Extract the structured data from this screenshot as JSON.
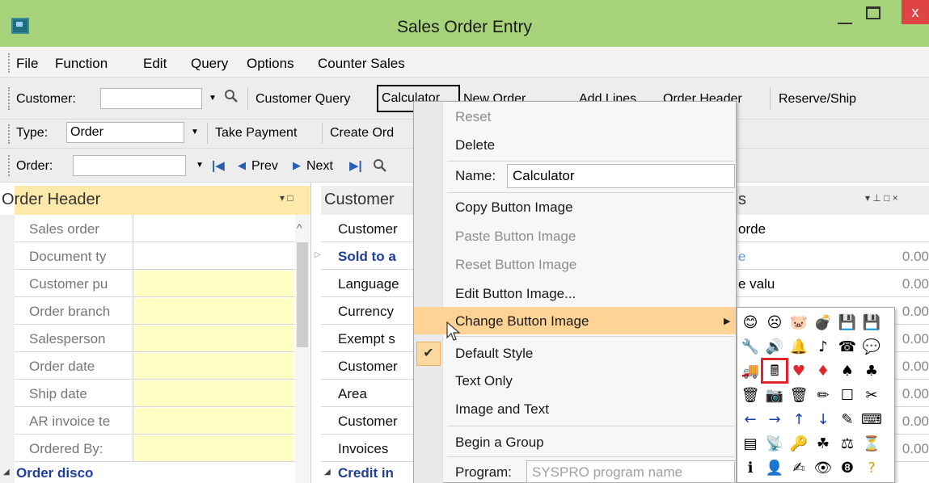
{
  "window": {
    "title": "Sales Order Entry",
    "close_glyph": "x"
  },
  "menubar": {
    "items": [
      "File",
      "Function",
      "Edit",
      "Query",
      "Options",
      "Counter Sales"
    ]
  },
  "toolbar1": {
    "customer_label": "Customer:",
    "customer_value": "",
    "customer_query": "Customer Query",
    "calculator": "Calculator",
    "new_order": "New Order",
    "add_lines": "Add Lines",
    "order_header": "Order Header",
    "reserve_ship": "Reserve/Ship"
  },
  "toolbar2": {
    "type_label": "Type:",
    "type_value": "Order",
    "take_payment": "Take Payment",
    "create_order": "Create Ord"
  },
  "toolbar3": {
    "order_label": "Order:",
    "order_value": "",
    "prev": "Prev",
    "next": "Next"
  },
  "left_pane": {
    "title": "Order Header",
    "rows": [
      "Sales order",
      "Document ty",
      "Customer pu",
      "Order branch",
      "Salesperson",
      "Order date",
      "Ship date",
      "AR invoice te",
      "Ordered By:"
    ],
    "section": "Order disco"
  },
  "right_pane": {
    "title": "Customer",
    "title_right": "s",
    "rows": [
      {
        "label": "Customer",
        "right": "orde",
        "value": ""
      },
      {
        "label": "Sold to a",
        "right": "e",
        "value": "0.00"
      },
      {
        "label": "Language",
        "right": "e valu",
        "value": "0.00"
      },
      {
        "label": "Currency",
        "right": "",
        "value": "0.00"
      },
      {
        "label": "Exempt s",
        "right": "",
        "value": "0.00"
      },
      {
        "label": "Customer",
        "right": "",
        "value": "0.00"
      },
      {
        "label": "Area",
        "right": "",
        "value": "0.00"
      },
      {
        "label": "Customer",
        "right": "",
        "value": "0.00"
      },
      {
        "label": "Invoices",
        "right": "",
        "value": "0.00"
      }
    ],
    "section": "Credit in"
  },
  "context_menu": {
    "reset": "Reset",
    "delete": "Delete",
    "name_label": "Name:",
    "name_value": "Calculator",
    "copy_image": "Copy Button Image",
    "paste_image": "Paste Button Image",
    "reset_image": "Reset Button Image",
    "edit_image": "Edit Button Image...",
    "change_image": "Change Button Image",
    "default_style": "Default Style",
    "text_only": "Text Only",
    "image_and_text": "Image and Text",
    "begin_group": "Begin a Group",
    "program_label": "Program:",
    "program_placeholder": "SYSPRO program name"
  },
  "palette": {
    "rows": [
      [
        "😊",
        "☹",
        "🐷",
        "💣",
        "💾",
        "💾"
      ],
      [
        "🔧",
        "🔊",
        "🔔",
        "♪",
        "☎",
        "💬"
      ],
      [
        "🚚",
        "🖩",
        "♥",
        "♦",
        "♠",
        "♣"
      ],
      [
        "🗑",
        "📷",
        "🗑",
        "✏",
        "☐",
        "✂"
      ],
      [
        "←",
        "→",
        "↑",
        "↓",
        "✎",
        "⌨"
      ],
      [
        "▤",
        "📡",
        "🔑",
        "☘",
        "⚖",
        "⏳"
      ],
      [
        "ℹ",
        "👤",
        "✍",
        "👁",
        "❽",
        "?"
      ]
    ]
  },
  "colors": {
    "titlebar": "#a7d47a",
    "highlight": "#fed395",
    "input_yellow": "#fffec4",
    "section_blue": "#1e3f9c",
    "palette_selection": "#e0262e"
  }
}
